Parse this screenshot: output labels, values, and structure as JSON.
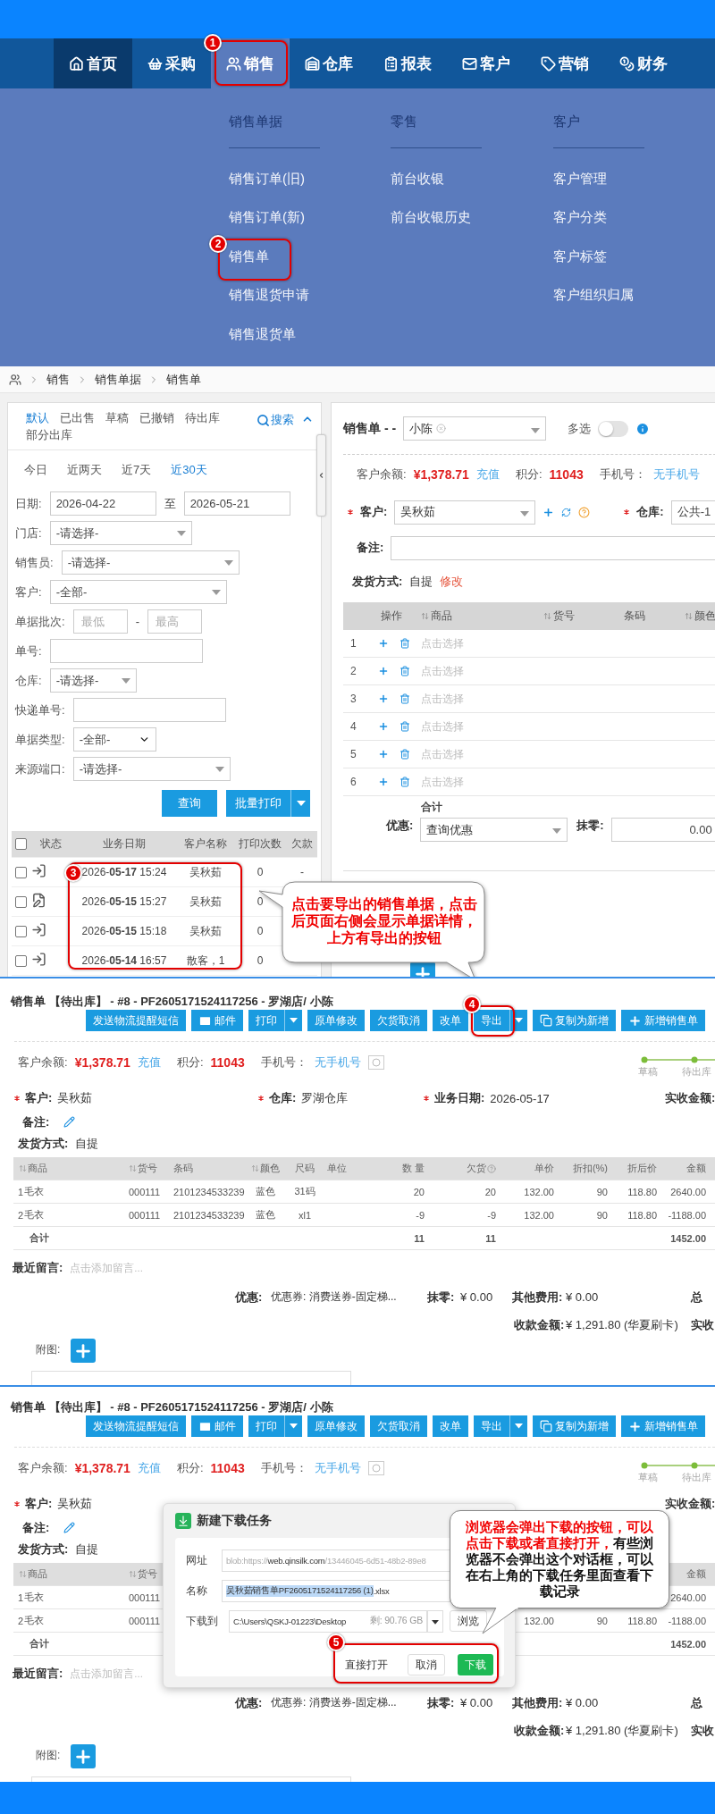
{
  "top_nav": {
    "items": [
      {
        "label": "首页",
        "selected": true,
        "expanded": false
      },
      {
        "label": "采购",
        "selected": false,
        "expanded": false
      },
      {
        "label": "销售",
        "selected": false,
        "expanded": true,
        "marker": "1"
      },
      {
        "label": "仓库",
        "selected": false,
        "expanded": false
      },
      {
        "label": "报表",
        "selected": false,
        "expanded": false
      },
      {
        "label": "客户",
        "selected": false,
        "expanded": false
      },
      {
        "label": "营销",
        "selected": false,
        "expanded": false
      },
      {
        "label": "财务",
        "selected": false,
        "expanded": false
      }
    ]
  },
  "menu": {
    "columns": [
      {
        "heading": "销售单据",
        "items": [
          {
            "label": "销售订单(旧)"
          },
          {
            "label": "销售订单(新)"
          },
          {
            "label": "销售单",
            "marker": "2"
          },
          {
            "label": "销售退货申请"
          },
          {
            "label": "销售退货单"
          }
        ]
      },
      {
        "heading": "零售",
        "items": [
          {
            "label": "前台收银"
          },
          {
            "label": "前台收银历史"
          }
        ]
      },
      {
        "heading": "客户",
        "items": [
          {
            "label": "客户管理"
          },
          {
            "label": "客户分类"
          },
          {
            "label": "客户标签"
          },
          {
            "label": "客户组织归属"
          }
        ]
      }
    ]
  },
  "list_screen": {
    "breadcrumb": [
      "销售",
      "销售单据",
      "销售单"
    ],
    "status_tabs": [
      {
        "label": "默认",
        "selected": true
      },
      {
        "label": "已出售",
        "selected": false
      },
      {
        "label": "草稿",
        "selected": false
      },
      {
        "label": "已撤销",
        "selected": false
      },
      {
        "label": "待出库",
        "selected": false
      },
      {
        "label": "部分出库",
        "selected": false
      }
    ],
    "search": "搜索",
    "date_tabs": [
      {
        "label": "今日",
        "selected": false
      },
      {
        "label": "近两天",
        "selected": false
      },
      {
        "label": "近7天",
        "selected": false
      },
      {
        "label": "近30天",
        "selected": true
      }
    ],
    "filters": [
      {
        "kind": "date_range",
        "label": "日期:",
        "from": "2026-04-22",
        "separator": "至",
        "to": "2026-05-21"
      },
      {
        "kind": "select",
        "label": "门店:",
        "value": "-请选择-"
      },
      {
        "kind": "select",
        "label": "销售员:",
        "value": "-请选择-"
      },
      {
        "kind": "select",
        "label": "客户:",
        "value": "-全部-"
      },
      {
        "kind": "min_max",
        "label": "单据批次:",
        "min_placeholder": "最低",
        "separator": "-",
        "max_placeholder": "最高"
      },
      {
        "kind": "text",
        "label": "单号:"
      },
      {
        "kind": "select",
        "label": "仓库:",
        "value": "-请选择-"
      },
      {
        "kind": "text",
        "label": "快递单号:"
      },
      {
        "kind": "native_select",
        "label": "单据类型:",
        "value": "-全部-"
      },
      {
        "kind": "select",
        "label": "来源端口:",
        "value": "-请选择-"
      }
    ],
    "query_button": "查询",
    "batch_print_button": "批量打印",
    "list": {
      "columns": [
        "状态",
        "业务日期",
        "客户名称",
        "打印次数",
        "欠款"
      ],
      "all_checked": false,
      "marker": "3",
      "rows": [
        {
          "kind": "shipped",
          "checked": false,
          "date": "2026-**05-17** 15:24",
          "customer": "吴秋茹",
          "prints": "0",
          "debt": "-"
        },
        {
          "kind": "draft",
          "checked": false,
          "date": "2026-**05-15** 15:27",
          "customer": "吴秋茹",
          "prints": "0"
        },
        {
          "kind": "shipped",
          "checked": false,
          "date": "2026-**05-15** 15:18",
          "customer": "吴秋茹",
          "prints": "0"
        },
        {
          "kind": "shipped",
          "checked": false,
          "date": "2026-**05-14** 16:57",
          "customer": "散客，1",
          "prints": "0"
        }
      ]
    },
    "order": {
      "title": "销售单 - -",
      "salesperson": "小陈",
      "multi_select_label": "多选",
      "multi_select_on": false,
      "balance_label": "客户余额:",
      "balance": "¥1,378.71",
      "recharge": "充值",
      "points_label": "积分:",
      "points": "11043",
      "phone_label": "手机号：",
      "phone": "无手机号",
      "customer_label": "客户:",
      "customer": "吴秋茹",
      "warehouse_label": "仓库:",
      "warehouse": "公共-1",
      "remark_label": "备注:",
      "shipping_label": "发货方式:",
      "shipping": "自提",
      "shipping_edit": "修改",
      "columns": [
        "操作",
        "商品",
        "货号",
        "条码",
        "颜色"
      ],
      "rows": [
        {
          "no": "1",
          "placeholder": "点击选择"
        },
        {
          "no": "2",
          "placeholder": "点击选择"
        },
        {
          "no": "3",
          "placeholder": "点击选择"
        },
        {
          "no": "4",
          "placeholder": "点击选择"
        },
        {
          "no": "5",
          "placeholder": "点击选择"
        },
        {
          "no": "6",
          "placeholder": "点击选择"
        }
      ],
      "total_label": "合计",
      "discount_label": "优惠:",
      "discount": "查询优惠",
      "rounding_label": "抹零:",
      "rounding": "0.00"
    },
    "callout": "点击要导出的销售单据，点击后页面右侧会显示单据详情，上方有导出的按钮"
  },
  "detail_screens": [
    {
      "title": "销售单 【待出库】 - #8 - PF2605171524117256 - 罗湖店/ 小陈",
      "toolbar": [
        {
          "label": "发送物流提醒短信",
          "kind": "plain"
        },
        {
          "label": "邮件",
          "kind": "mail"
        },
        {
          "label": "打印",
          "kind": "split"
        },
        {
          "label": "原单修改",
          "kind": "plain"
        },
        {
          "label": "欠货取消",
          "kind": "plain"
        },
        {
          "label": "改单",
          "kind": "plain"
        },
        {
          "label": "导出",
          "kind": "split",
          "marker": "4"
        },
        {
          "label": "复制为新增",
          "kind": "copy"
        },
        {
          "label": "新增销售单",
          "kind": "add"
        }
      ],
      "balance_label": "客户余额:",
      "balance": "¥1,378.71",
      "recharge": "充值",
      "points_label": "积分:",
      "points": "11043",
      "phone_label": "手机号：",
      "phone": "无手机号",
      "steps": [
        {
          "label": "草稿",
          "done": true
        },
        {
          "label": "待出库",
          "done": true
        }
      ],
      "fields": {
        "customer": {
          "label": "客户:",
          "value": "吴秋茹",
          "required": true
        },
        "warehouse": {
          "label": "仓库:",
          "value": "罗湖仓库",
          "required": true
        },
        "date": {
          "label": "业务日期:",
          "value": "2026-05-17",
          "required": true
        },
        "received": {
          "label": "实收金额:",
          "required": false
        }
      },
      "remark_label": "备注:",
      "shipping_label": "发货方式:",
      "shipping": "自提",
      "table": {
        "header": {
          "name": "商品",
          "sku": "货号",
          "barcode": "条码",
          "shade": "颜色",
          "size": "尺码",
          "unit": "单位",
          "qty": "数 量",
          "owed": "欠货",
          "price": "单价",
          "discount": "折扣(%)",
          "net": "折后价",
          "amount": "金额"
        },
        "rows": [
          {
            "no": "1",
            "name": "毛衣",
            "sku": "000111",
            "barcode": "2101234533239",
            "shade": "蓝色",
            "size": "31码",
            "qty": "20",
            "owed": "20",
            "price": "132.00",
            "discount": "90",
            "net": "118.80",
            "amount": "2640.00"
          },
          {
            "no": "2",
            "name": "毛衣",
            "sku": "000111",
            "barcode": "2101234533239",
            "shade": "蓝色",
            "size": "xl1",
            "qty": "-9",
            "owed": "-9",
            "price": "132.00",
            "discount": "90",
            "net": "118.80",
            "amount": "-1188.00"
          }
        ],
        "total": {
          "name": "合计",
          "qty": "11",
          "owed": "11",
          "amount": "1452.00"
        }
      },
      "recent_label": "最近留言:",
      "recent_placeholder": "点击添加留言...",
      "coupon_label": "优惠:",
      "coupon": "优惠券: 消费送券-固定梯...",
      "rounding_label": "抹零:",
      "rounding": "¥ 0.00",
      "other_label": "其他费用:",
      "other": "¥ 0.00",
      "total_cut": "总",
      "paid_label": "收款金额:",
      "paid": "¥ 1,291.80 (华夏刷卡)",
      "received_cut": "实收",
      "attach_label": "附图:"
    },
    {
      "title": "销售单 【待出库】 - #8 - PF2605171524117256 - 罗湖店/ 小陈",
      "toolbar": [
        {
          "label": "发送物流提醒短信",
          "kind": "plain"
        },
        {
          "label": "邮件",
          "kind": "mail"
        },
        {
          "label": "打印",
          "kind": "split"
        },
        {
          "label": "原单修改",
          "kind": "plain"
        },
        {
          "label": "欠货取消",
          "kind": "plain"
        },
        {
          "label": "改单",
          "kind": "plain"
        },
        {
          "label": "导出",
          "kind": "split"
        },
        {
          "label": "复制为新增",
          "kind": "copy"
        },
        {
          "label": "新增销售单",
          "kind": "add"
        }
      ],
      "balance_label": "客户余额:",
      "balance": "¥1,378.71",
      "recharge": "充值",
      "points_label": "积分:",
      "points": "11043",
      "phone_label": "手机号：",
      "phone": "无手机号",
      "steps": [
        {
          "label": "草稿",
          "done": true
        },
        {
          "label": "待出库",
          "done": true
        }
      ],
      "fields": {
        "customer": {
          "label": "客户:",
          "value": "吴秋茹",
          "required": true
        },
        "received": {
          "label": "实收金额:",
          "required": false
        }
      },
      "remark_label": "备注:",
      "shipping_label": "发货方式:",
      "shipping": "自提",
      "table": {
        "header": {
          "name": "商品",
          "sku": "货号",
          "amount": "金额"
        },
        "rows": [
          {
            "no": "1",
            "name": "毛衣",
            "sku": "000111",
            "amount": "2640.00"
          },
          {
            "no": "2",
            "name": "毛衣",
            "sku": "000111",
            "price": "132.00",
            "discount": "90",
            "net": "118.80",
            "amount": "-1188.00"
          }
        ],
        "total": {
          "name": "合计",
          "amount": "1452.00"
        }
      },
      "recent_label": "最近留言:",
      "recent_placeholder": "点击添加留言...",
      "coupon_label": "优惠:",
      "coupon": "优惠券: 消费送券-固定梯...",
      "rounding_label": "抹零:",
      "rounding": "¥ 0.00",
      "other_label": "其他费用:",
      "other": "¥ 0.00",
      "total_cut": "总",
      "paid_label": "收款金额:",
      "paid": "¥ 1,291.80 (华夏刷卡)",
      "received_cut": "实收",
      "attach_label": "附图:",
      "dialog": {
        "title": "新建下载任务",
        "url_label": "网址",
        "url": "blob:https://**web.qinsilk.com**/13446045-6d51-48b2-89e8",
        "name_label": "名称",
        "name_selected": "吴秋茹销售单PF2605171524117256 (1)",
        "name_ext": ".xlsx",
        "dest_label": "下载到",
        "dest": "C:\\Users\\QSKJ-01223\\Desktop",
        "free": "剩: 90.76 GB",
        "browse": "浏览",
        "open_button": "直接打开",
        "cancel_button": "取消",
        "download_button": "下载",
        "marker": "5"
      },
      "callout": [
        {
          "text": "浏览器会弹出下载的按钮，可以点击下载或者直接打开，",
          "emphasis": true
        },
        {
          "text": "有些浏览器不会弹出这个对话框，可以在右上角的下载任务里面查看下载记录",
          "emphasis": false
        }
      ]
    }
  ]
}
